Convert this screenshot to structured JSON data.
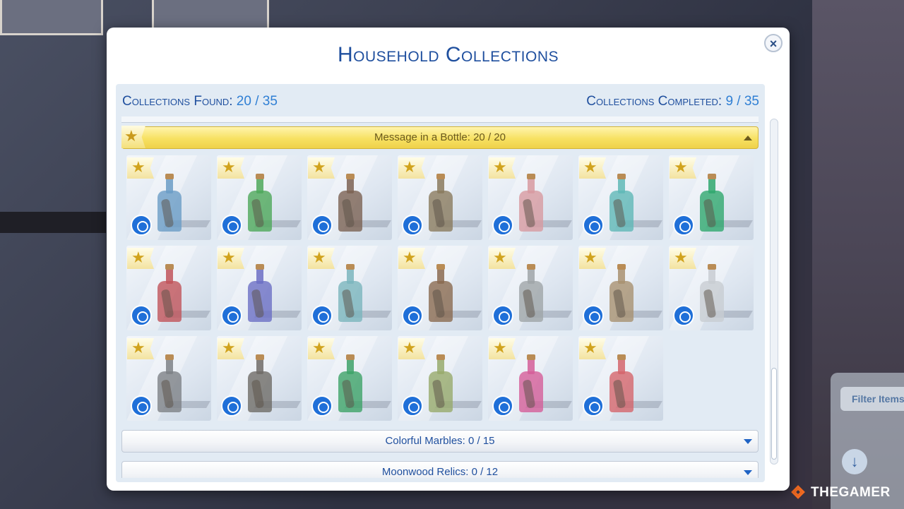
{
  "dialog": {
    "title": "Household Collections",
    "close_label": "×"
  },
  "stats": {
    "found_label": "Collections Found:",
    "found_value": "20 / 35",
    "completed_label": "Collections Completed:",
    "completed_value": "9 / 35"
  },
  "categories": [
    {
      "label": "Message in a Bottle: 20 / 20",
      "expanded": true
    },
    {
      "label": "Colorful Marbles: 0 / 15",
      "expanded": false
    },
    {
      "label": "Moonwood Relics: 0 / 12",
      "expanded": false
    }
  ],
  "items": [
    {
      "color": "#6a9cc6"
    },
    {
      "color": "#4ea85a"
    },
    {
      "color": "#7b6252"
    },
    {
      "color": "#8a7a5e"
    },
    {
      "color": "#d79aa0"
    },
    {
      "color": "#5fb8b6"
    },
    {
      "color": "#2fa86e"
    },
    {
      "color": "#c0545a"
    },
    {
      "color": "#6c6fc4"
    },
    {
      "color": "#7ab5bd"
    },
    {
      "color": "#8a6a50"
    },
    {
      "color": "#9fa5a8"
    },
    {
      "color": "#a89170"
    },
    {
      "color": "#c8cdd2"
    },
    {
      "color": "#7d8186"
    },
    {
      "color": "#6e6b67"
    },
    {
      "color": "#3da268"
    },
    {
      "color": "#97aa6c"
    },
    {
      "color": "#d45e98"
    },
    {
      "color": "#d4656c"
    }
  ],
  "side": {
    "filter_label": "Filter Items",
    "down_symbol": "↓"
  },
  "watermark": "THEGAMER"
}
